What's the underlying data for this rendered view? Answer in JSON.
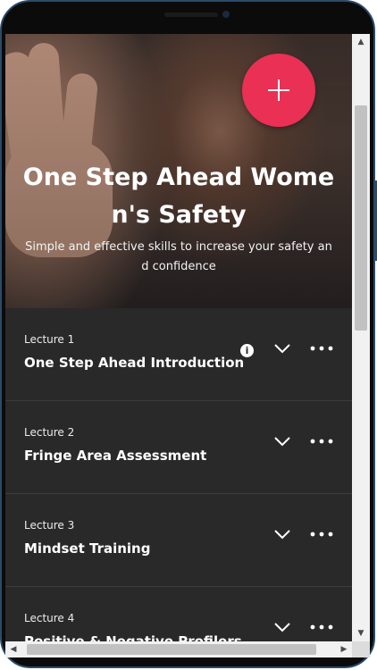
{
  "course": {
    "title": "One Step Ahead Women's Safety",
    "subtitle": "Simple and effective skills to increase your safety and confidence"
  },
  "fab": {
    "icon": "plus-icon",
    "color": "#ea3055"
  },
  "lectures": [
    {
      "number": "Lecture 1",
      "title": "One Step Ahead Introduction",
      "badge": "i"
    },
    {
      "number": "Lecture 2",
      "title": "Fringe Area Assessment"
    },
    {
      "number": "Lecture 3",
      "title": "Mindset Training"
    },
    {
      "number": "Lecture 4",
      "title": "Positive & Negative Profilers"
    }
  ],
  "icons": {
    "expand": "chevron-down-icon",
    "more": "more-horizontal-icon"
  },
  "colors": {
    "list_background": "#292929",
    "accent": "#ea3055",
    "frame": "#2b4a6a"
  }
}
